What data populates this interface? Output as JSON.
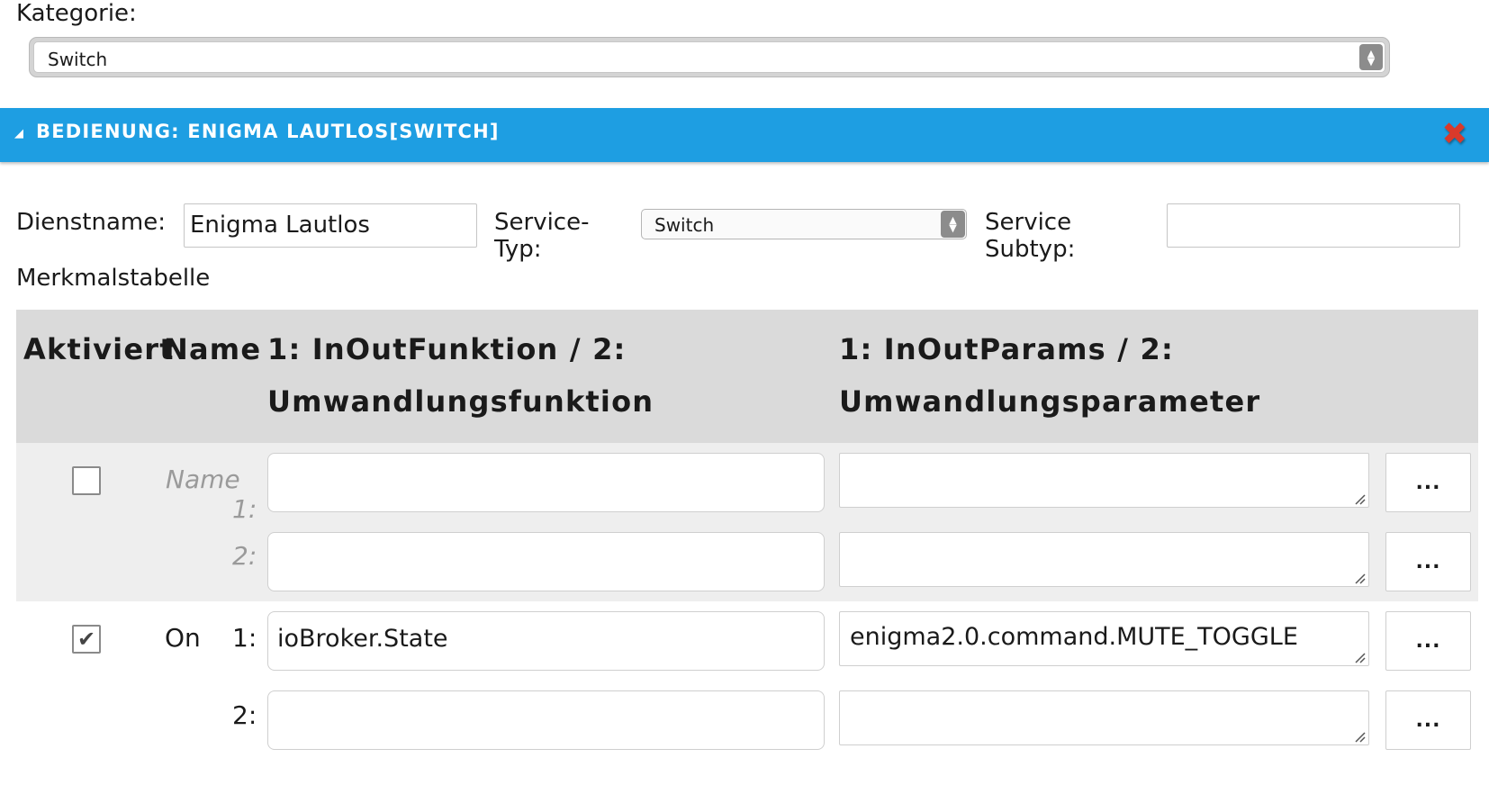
{
  "kategorie": {
    "label": "Kategorie:",
    "value": "Switch"
  },
  "header": {
    "title": "BEDIENUNG: ENIGMA LAUTLOS[SWITCH]",
    "toggle_icon": "triangle-down",
    "close_icon": "close-x",
    "accent_color": "#1e9ee2",
    "close_color": "#d93a2b"
  },
  "service": {
    "dienstname_label": "Dienstname:",
    "dienstname_value": "Enigma Lautlos",
    "servicetyp_label_1": "Service-",
    "servicetyp_label_2": "Typ:",
    "servicetyp_value": "Switch",
    "subtyp_label_1": "Service",
    "subtyp_label_2": "Subtyp:",
    "subtyp_value": ""
  },
  "table": {
    "caption": "Merkmalstabelle",
    "headers": {
      "aktiviert": "Aktiviert",
      "name": "Name",
      "funktion_1": "1: InOutFunktion / 2:",
      "funktion_2": "Umwandlungsfunktion",
      "params_1": "1: InOutParams / 2:",
      "params_2": "Umwandlungsparameter"
    },
    "more_label": "...",
    "rows": [
      {
        "checked": false,
        "name": "",
        "name_placeholder": "Name",
        "n1": "1:",
        "n2": "2:",
        "funktion_1": "",
        "funktion_2": "",
        "params_1": "",
        "params_2": ""
      },
      {
        "checked": true,
        "check_mark": "✔",
        "name": "On",
        "n1": "1:",
        "n2": "2:",
        "funktion_1": "ioBroker.State",
        "funktion_2": "",
        "params_1": "enigma2.0.command.MUTE_TOGGLE",
        "params_2": ""
      }
    ]
  }
}
